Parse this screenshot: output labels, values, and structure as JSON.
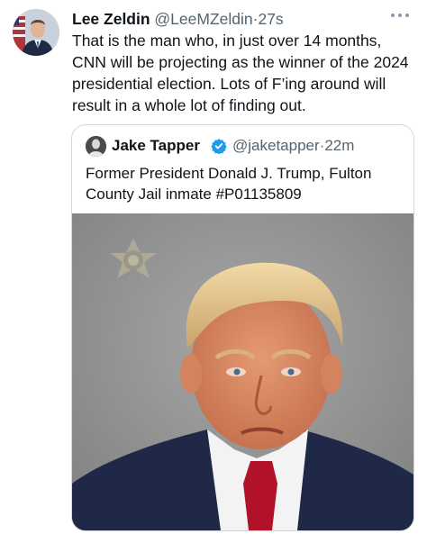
{
  "tweet": {
    "author_name": "Lee Zeldin",
    "author_handle": "@LeeMZeldin",
    "separator": "·",
    "timestamp": "27s",
    "more_icon": "more-options-icon",
    "text": "That is the man who, in just over 14 months, CNN will be projecting as the winner of the 2024 presidential election. Lots of F’ing around will result in a whole lot of finding out."
  },
  "quoted_tweet": {
    "author_name": "Jake Tapper",
    "verified_icon": "verified-badge-icon",
    "verified_color": "#1d9bf0",
    "author_handle": "@jaketapper",
    "separator": "·",
    "timestamp": "22m",
    "text": "Former President Donald J. Trump, Fulton County Jail inmate #P01135809",
    "media_icon": "mugshot-photo"
  }
}
